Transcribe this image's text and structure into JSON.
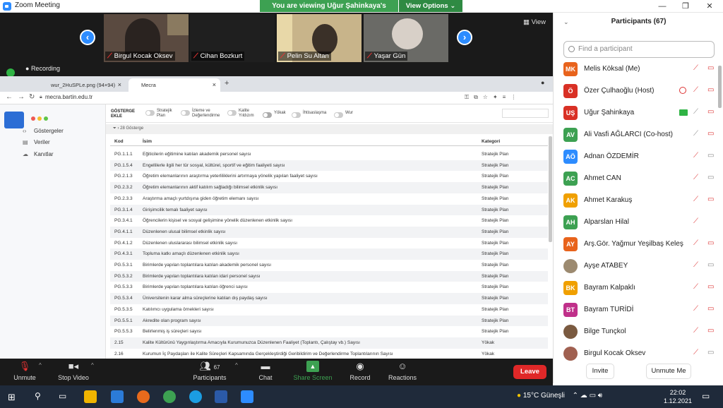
{
  "window": {
    "title": "Zoom Meeting",
    "min": "—",
    "max": "❐",
    "close": "✕"
  },
  "banner": {
    "viewing": "You are viewing Uğur Şahinkaya's screen",
    "options": "View Options ⌄"
  },
  "strip": {
    "view": "View",
    "tiles": [
      {
        "name": "Birgul Kocak Oksev"
      },
      {
        "name": "Cihan Bozkurt"
      },
      {
        "name": "Pelin Su Altan"
      },
      {
        "name": "Yaşar Gün"
      }
    ]
  },
  "shared": {
    "recording": "Recording",
    "tabs": [
      {
        "label": "wur_2HuSPLe.png (94×94)"
      },
      {
        "label": "Mecra"
      }
    ],
    "url": "mecra.bartin.edu.tr",
    "sidebar": [
      "Göstergeler",
      "Veriler",
      "Kanıtlar"
    ],
    "filters": {
      "label": "GÖSTERGE EKLE",
      "toggles": [
        "Stratejik Plan",
        "İzleme ve Değerlendirme",
        "Kalite Yıldızım",
        "Yökak",
        "İhtisaslaşma",
        "Wur"
      ]
    },
    "count": "28 Gösterge",
    "columns": [
      "Kod",
      "İsim",
      "Kategori"
    ],
    "rows": [
      [
        "PG.1.1.1",
        "Eğiticilerin eğitimine katılan akademik personel sayısı",
        "Stratejik Plan"
      ],
      [
        "PG.1.5.4",
        "Engellilerle ilgili her tür sosyal, kültürel, sportif ve eğitim faaliyeti sayısı",
        "Stratejik Plan"
      ],
      [
        "PG.2.1.3",
        "Öğretim elemanlarının araştırma yeterliliklerini artırmaya yönelik yapılan faaliyet sayısı",
        "Stratejik Plan"
      ],
      [
        "PG.2.3.2",
        "Öğretim elemanlarının aktif katılım sağladığı bilimsel etkinlik sayısı",
        "Stratejik Plan"
      ],
      [
        "PG.2.3.3",
        "Araştırma amaçlı yurtdışına giden öğretim elemanı sayısı",
        "Stratejik Plan"
      ],
      [
        "PG.3.1.4",
        "Girişimcilik temalı faaliyet sayısı",
        "Stratejik Plan"
      ],
      [
        "PG.3.4.1",
        "Öğrencilerin kişisel ve sosyal gelişimine yönelik düzenlenen etkinlik sayısı",
        "Stratejik Plan"
      ],
      [
        "PG.4.1.1",
        "Düzenlenen ulusal bilimsel etkinlik sayısı",
        "Stratejik Plan"
      ],
      [
        "PG.4.1.2",
        "Düzenlenen uluslararası bilimsel etkinlik sayısı",
        "Stratejik Plan"
      ],
      [
        "PG.4.3.1",
        "Topluma katkı amaçlı düzenlenen etkinlik sayısı",
        "Stratejik Plan"
      ],
      [
        "PG.5.3.1",
        "Birimlerde yapılan toplantılara katılan akademik personel sayısı",
        "Stratejik Plan"
      ],
      [
        "PG.5.3.2",
        "Birimlerde yapılan toplantılara katılan idari personel sayısı",
        "Stratejik Plan"
      ],
      [
        "PG.5.3.3",
        "Birimlerde yapılan toplantılara katılan öğrenci sayısı",
        "Stratejik Plan"
      ],
      [
        "PG.5.3.4",
        "Üniversitenin karar alma süreçlerine katılan dış paydaş sayısı",
        "Stratejik Plan"
      ],
      [
        "PG.5.3.5",
        "Katılımcı uygulama örnekleri sayısı",
        "Stratejik Plan"
      ],
      [
        "PG.5.5.1",
        "Akredite olan program sayısı",
        "Stratejik Plan"
      ],
      [
        "PG.5.5.3",
        "Belirlenmiş iş süreçleri sayısı",
        "Stratejik Plan"
      ],
      [
        "2.15",
        "Kalite Kültürünü Yaygınlaştırma Amacıyla Kurumunuzca Düzenlenen Faaliyet (Toplantı, Çalıştay vb.) Sayısı",
        "Yökak"
      ],
      [
        "2.16",
        "Kurumun İç Paydaşları ile Kalite Süreçleri Kapsamında Gerçekleştirdiği Geribildirim ve Değerlendirme Toplantılarının Sayısı",
        "Yökak"
      ]
    ]
  },
  "participants": {
    "title": "Participants (67)",
    "search_placeholder": "Find a participant",
    "list": [
      {
        "initials": "MK",
        "name": "Melis Köksal (Me)",
        "color": "#e8631c"
      },
      {
        "initials": "Ö",
        "name": "Özer Çulhaoğlu (Host)",
        "color": "#d93025"
      },
      {
        "initials": "UŞ",
        "name": "Uğur Şahinkaya",
        "color": "#d93025"
      },
      {
        "initials": "AV",
        "name": "Ali Vasfi AĞLARCI (Co-host)",
        "color": "#3da152"
      },
      {
        "initials": "AÖ",
        "name": "Adnan ÖZDEMİR",
        "color": "#2d8cff"
      },
      {
        "initials": "AC",
        "name": "Ahmet CAN",
        "color": "#3da152"
      },
      {
        "initials": "AK",
        "name": "Ahmet Karakuş",
        "color": "#f0a000"
      },
      {
        "initials": "AH",
        "name": "Alparslan Hilal",
        "color": "#3da152"
      },
      {
        "initials": "AY",
        "name": "Arş.Gör. Yağmur Yeşilbaş Keleş",
        "color": "#e8631c"
      },
      {
        "initials": "",
        "name": "Ayşe ATABEY",
        "color": "#9c8a70"
      },
      {
        "initials": "BK",
        "name": "Bayram Kalpaklı",
        "color": "#f0a000"
      },
      {
        "initials": "BT",
        "name": "Bayram TURİDİ",
        "color": "#c0308a"
      },
      {
        "initials": "",
        "name": "Bilge Tunçkol",
        "color": "#7a5a40"
      },
      {
        "initials": "",
        "name": "Birgul Kocak Oksev",
        "color": "#a06050"
      }
    ],
    "invite": "Invite",
    "unmute": "Unmute Me"
  },
  "toolbar": {
    "unmute": "Unmute",
    "video": "Stop Video",
    "participants": "Participants",
    "pcount": "67",
    "chat": "Chat",
    "share": "Share Screen",
    "record": "Record",
    "reactions": "Reactions",
    "leave": "Leave"
  },
  "taskbar": {
    "weather": "15°C  Güneşli",
    "time": "22:02",
    "date": "1.12.2021"
  }
}
